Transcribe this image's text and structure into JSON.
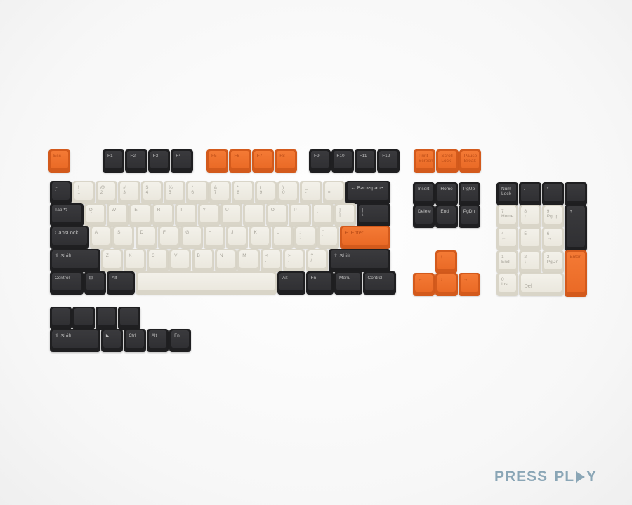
{
  "brand": {
    "press": "PRESS",
    "pl": "PL",
    "y": "Y",
    "color": "#8aa6b6"
  },
  "colors": {
    "dark": "#333336",
    "cream": "#efece3",
    "orange": "#f07030"
  },
  "keys": [
    {
      "id": "esc",
      "label": "Esc",
      "color": "orange"
    },
    {
      "id": "f1",
      "label": "F1",
      "color": "dark"
    },
    {
      "id": "f2",
      "label": "F2",
      "color": "dark"
    },
    {
      "id": "f3",
      "label": "F3",
      "color": "dark"
    },
    {
      "id": "f4",
      "label": "F4",
      "color": "dark"
    },
    {
      "id": "f5",
      "label": "F5",
      "color": "orange"
    },
    {
      "id": "f6",
      "label": "F6",
      "color": "orange"
    },
    {
      "id": "f7",
      "label": "F7",
      "color": "orange"
    },
    {
      "id": "f8",
      "label": "F8",
      "color": "orange"
    },
    {
      "id": "f9",
      "label": "F9",
      "color": "dark"
    },
    {
      "id": "f10",
      "label": "F10",
      "color": "dark"
    },
    {
      "id": "f11",
      "label": "F11",
      "color": "dark"
    },
    {
      "id": "f12",
      "label": "F12",
      "color": "dark"
    },
    {
      "id": "prtsc",
      "label": "Print\nScreen",
      "color": "orange"
    },
    {
      "id": "scrlk",
      "label": "Scroll\nLock",
      "color": "orange"
    },
    {
      "id": "pause",
      "label": "Pause\nBreak",
      "color": "orange"
    },
    {
      "id": "grave",
      "label": "~\n`",
      "color": "dark"
    },
    {
      "id": "n1",
      "label": "!\n1",
      "color": "cream"
    },
    {
      "id": "n2",
      "label": "@\n2",
      "color": "cream"
    },
    {
      "id": "n3",
      "label": "#\n3",
      "color": "cream"
    },
    {
      "id": "n4",
      "label": "$\n4",
      "color": "cream"
    },
    {
      "id": "n5",
      "label": "%\n5",
      "color": "cream"
    },
    {
      "id": "n6",
      "label": "^\n6",
      "color": "cream"
    },
    {
      "id": "n7",
      "label": "&\n7",
      "color": "cream"
    },
    {
      "id": "n8",
      "label": "*\n8",
      "color": "cream"
    },
    {
      "id": "n9",
      "label": "(\n9",
      "color": "cream"
    },
    {
      "id": "n0",
      "label": ")\n0",
      "color": "cream"
    },
    {
      "id": "minus",
      "label": "_\n-",
      "color": "cream"
    },
    {
      "id": "equal",
      "label": "+\n=",
      "color": "cream"
    },
    {
      "id": "backspace",
      "label": "← Backspace",
      "color": "dark"
    },
    {
      "id": "tab",
      "label": "Tab ⇆",
      "color": "dark"
    },
    {
      "id": "q",
      "label": "Q",
      "color": "cream"
    },
    {
      "id": "w",
      "label": "W",
      "color": "cream"
    },
    {
      "id": "e",
      "label": "E",
      "color": "cream"
    },
    {
      "id": "r",
      "label": "R",
      "color": "cream"
    },
    {
      "id": "t",
      "label": "T",
      "color": "cream"
    },
    {
      "id": "y",
      "label": "Y",
      "color": "cream"
    },
    {
      "id": "u",
      "label": "U",
      "color": "cream"
    },
    {
      "id": "i",
      "label": "I",
      "color": "cream"
    },
    {
      "id": "o",
      "label": "O",
      "color": "cream"
    },
    {
      "id": "p",
      "label": "P",
      "color": "cream"
    },
    {
      "id": "lbracket",
      "label": "{\n[",
      "color": "cream"
    },
    {
      "id": "rbracket",
      "label": "}\n]",
      "color": "cream"
    },
    {
      "id": "backslash",
      "label": "|\n\\",
      "color": "dark"
    },
    {
      "id": "capslock",
      "label": "CapsLock",
      "color": "dark"
    },
    {
      "id": "a",
      "label": "A",
      "color": "cream"
    },
    {
      "id": "s",
      "label": "S",
      "color": "cream"
    },
    {
      "id": "d",
      "label": "D",
      "color": "cream"
    },
    {
      "id": "f",
      "label": "F",
      "color": "cream"
    },
    {
      "id": "g",
      "label": "G",
      "color": "cream"
    },
    {
      "id": "h",
      "label": "H",
      "color": "cream"
    },
    {
      "id": "j",
      "label": "J",
      "color": "cream"
    },
    {
      "id": "k",
      "label": "K",
      "color": "cream"
    },
    {
      "id": "l",
      "label": "L",
      "color": "cream"
    },
    {
      "id": "semicolon",
      "label": ":\n;",
      "color": "cream"
    },
    {
      "id": "quote",
      "label": "\"\n'",
      "color": "cream"
    },
    {
      "id": "enter",
      "label": "↵ Enter",
      "color": "orange"
    },
    {
      "id": "lshift",
      "label": "⇧ Shift",
      "color": "dark"
    },
    {
      "id": "z",
      "label": "Z",
      "color": "cream"
    },
    {
      "id": "x",
      "label": "X",
      "color": "cream"
    },
    {
      "id": "c",
      "label": "C",
      "color": "cream"
    },
    {
      "id": "v",
      "label": "V",
      "color": "cream"
    },
    {
      "id": "b",
      "label": "B",
      "color": "cream"
    },
    {
      "id": "n",
      "label": "N",
      "color": "cream"
    },
    {
      "id": "m",
      "label": "M",
      "color": "cream"
    },
    {
      "id": "comma",
      "label": "<\n,",
      "color": "cream"
    },
    {
      "id": "period",
      "label": ">\n.",
      "color": "cream"
    },
    {
      "id": "slash",
      "label": "?\n/",
      "color": "cream"
    },
    {
      "id": "rshift",
      "label": "⇧ Shift",
      "color": "dark"
    },
    {
      "id": "lctrl",
      "label": "Control",
      "color": "dark"
    },
    {
      "id": "win",
      "label": "⊞",
      "color": "dark"
    },
    {
      "id": "lalt",
      "label": "Alt",
      "color": "dark"
    },
    {
      "id": "space",
      "label": "",
      "color": "cream"
    },
    {
      "id": "ralt",
      "label": "Alt",
      "color": "dark"
    },
    {
      "id": "fn",
      "label": "Fn",
      "color": "dark"
    },
    {
      "id": "menu",
      "label": "Menu",
      "color": "dark"
    },
    {
      "id": "rctrl",
      "label": "Control",
      "color": "dark"
    },
    {
      "id": "insert",
      "label": "Insert",
      "color": "dark"
    },
    {
      "id": "home",
      "label": "Home",
      "color": "dark"
    },
    {
      "id": "pgup",
      "label": "PgUp",
      "color": "dark"
    },
    {
      "id": "delete",
      "label": "Delete",
      "color": "dark"
    },
    {
      "id": "end",
      "label": "End",
      "color": "dark"
    },
    {
      "id": "pgdn",
      "label": "PgDn",
      "color": "dark"
    },
    {
      "id": "up",
      "label": "↑",
      "color": "orange"
    },
    {
      "id": "left",
      "label": "←",
      "color": "orange"
    },
    {
      "id": "down",
      "label": "↓",
      "color": "orange"
    },
    {
      "id": "right",
      "label": "→",
      "color": "orange"
    },
    {
      "id": "numlock",
      "label": "Num\nLock",
      "color": "dark"
    },
    {
      "id": "kpdiv",
      "label": "/",
      "color": "dark"
    },
    {
      "id": "kpmul",
      "label": "*",
      "color": "dark"
    },
    {
      "id": "kpminus",
      "label": "-",
      "color": "dark"
    },
    {
      "id": "kp7",
      "label": "7\nHome",
      "color": "cream"
    },
    {
      "id": "kp8",
      "label": "8\n↑",
      "color": "cream"
    },
    {
      "id": "kp9",
      "label": "9\nPgUp",
      "color": "cream"
    },
    {
      "id": "kpplus",
      "label": "+",
      "color": "dark"
    },
    {
      "id": "kp4",
      "label": "4\n←",
      "color": "cream"
    },
    {
      "id": "kp5",
      "label": "5",
      "color": "cream"
    },
    {
      "id": "kp6",
      "label": "6\n→",
      "color": "cream"
    },
    {
      "id": "kp1",
      "label": "1\nEnd",
      "color": "cream"
    },
    {
      "id": "kp2",
      "label": "2\n↓",
      "color": "cream"
    },
    {
      "id": "kp3",
      "label": "3\nPgDn",
      "color": "cream"
    },
    {
      "id": "kpenter",
      "label": "Enter",
      "color": "orange"
    },
    {
      "id": "kp0",
      "label": "0\nIns",
      "color": "cream"
    },
    {
      "id": "kpdot",
      "label": ".\nDel",
      "color": "cream"
    },
    {
      "id": "x1",
      "label": "",
      "color": "dark"
    },
    {
      "id": "x2",
      "label": "",
      "color": "dark"
    },
    {
      "id": "x3",
      "label": "",
      "color": "dark"
    },
    {
      "id": "x4",
      "label": "",
      "color": "dark"
    },
    {
      "id": "x_shift",
      "label": "⇧ Shift",
      "color": "dark"
    },
    {
      "id": "x_logo",
      "label": "◣",
      "color": "dark"
    },
    {
      "id": "x_ctrl",
      "label": "Ctrl",
      "color": "dark"
    },
    {
      "id": "x_alt",
      "label": "Alt",
      "color": "dark"
    },
    {
      "id": "x_fn",
      "label": "Fn",
      "color": "dark"
    }
  ]
}
